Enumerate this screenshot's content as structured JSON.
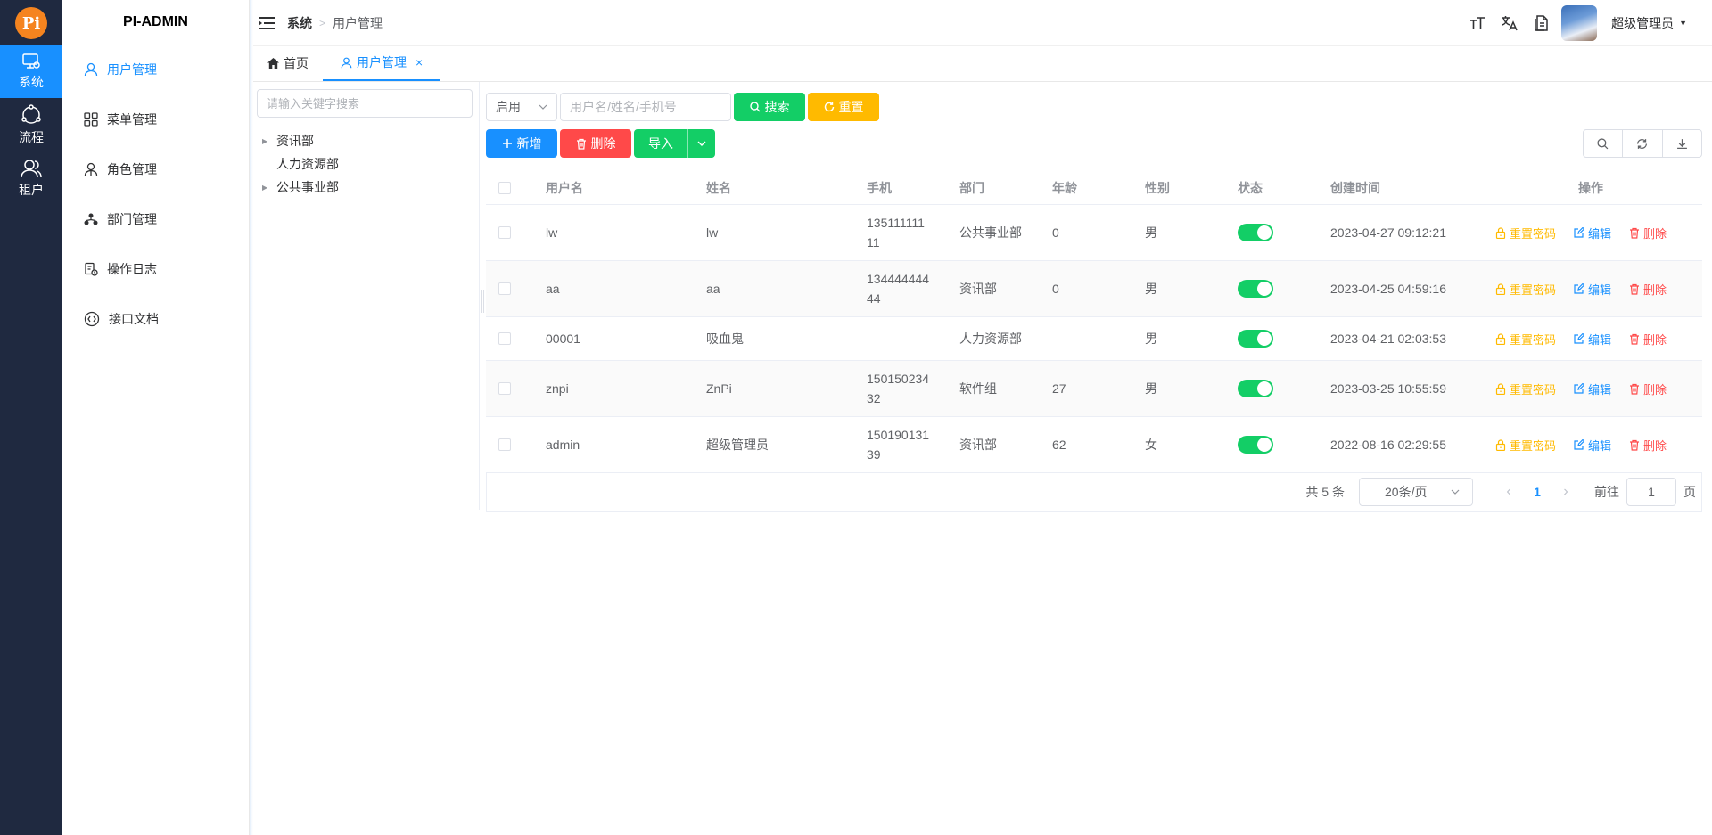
{
  "rail": {
    "logo": "Pi",
    "items": [
      {
        "label": "系统"
      },
      {
        "label": "流程"
      },
      {
        "label": "租户"
      }
    ]
  },
  "menu": {
    "brand": "PI-ADMIN",
    "items": [
      {
        "label": "用户管理"
      },
      {
        "label": "菜单管理"
      },
      {
        "label": "角色管理"
      },
      {
        "label": "部门管理"
      },
      {
        "label": "操作日志"
      },
      {
        "label": "接口文档"
      }
    ]
  },
  "header": {
    "breadcrumb": [
      "系统",
      "用户管理"
    ],
    "username": "超级管理员"
  },
  "tabs": [
    {
      "label": "首页"
    },
    {
      "label": "用户管理",
      "close": "×"
    }
  ],
  "tree": {
    "search_placeholder": "请输入关键字搜索",
    "nodes": [
      {
        "label": "资讯部"
      },
      {
        "label": "人力资源部"
      },
      {
        "label": "公共事业部"
      }
    ]
  },
  "filters": {
    "status_value": "启用",
    "keyword_placeholder": "用户名/姓名/手机号",
    "search_label": "搜索",
    "reset_label": "重置"
  },
  "actions": {
    "add_label": "新增",
    "delete_label": "删除",
    "import_label": "导入"
  },
  "table": {
    "headers": {
      "user": "用户名",
      "name": "姓名",
      "phone": "手机",
      "dept": "部门",
      "age": "年龄",
      "sex": "性别",
      "status": "状态",
      "time": "创建时间",
      "op": "操作"
    },
    "ops": {
      "reset": "重置密码",
      "edit": "编辑",
      "delete": "删除"
    },
    "rows": [
      {
        "user": "lw",
        "name": "lw",
        "phone1": "135111111",
        "phone2": "11",
        "dept": "公共事业部",
        "age": "0",
        "sex": "男",
        "time": "2023-04-27 09:12:21"
      },
      {
        "user": "aa",
        "name": "aa",
        "phone1": "134444444",
        "phone2": "44",
        "dept": "资讯部",
        "age": "0",
        "sex": "男",
        "time": "2023-04-25 04:59:16"
      },
      {
        "user": "00001",
        "name": "吸血鬼",
        "phone1": "",
        "phone2": "",
        "dept": "人力资源部",
        "age": "",
        "sex": "男",
        "time": "2023-04-21 02:03:53"
      },
      {
        "user": "znpi",
        "name": "ZnPi",
        "phone1": "150150234",
        "phone2": "32",
        "dept": "软件组",
        "age": "27",
        "sex": "男",
        "time": "2023-03-25 10:55:59"
      },
      {
        "user": "admin",
        "name": "超级管理员",
        "phone1": "150190131",
        "phone2": "39",
        "dept": "资讯部",
        "age": "62",
        "sex": "女",
        "time": "2022-08-16 02:29:55"
      }
    ]
  },
  "pagination": {
    "total": "共 5 条",
    "page_size": "20条/页",
    "current": "1",
    "goto_label": "前往",
    "goto_value": "1",
    "page_unit": "页"
  },
  "colors": {
    "rail_bg": "#1f2940",
    "primary": "#1890ff",
    "success": "#13ce66",
    "warning": "#ffba00",
    "danger": "#ff4949"
  }
}
